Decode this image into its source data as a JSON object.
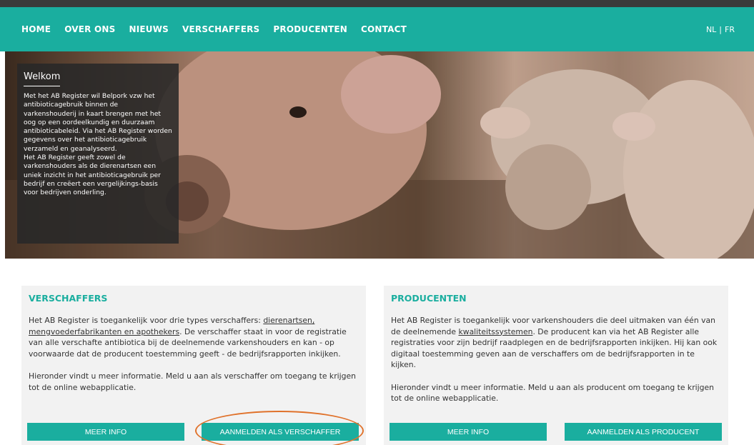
{
  "nav": {
    "items": [
      "HOME",
      "OVER ONS",
      "NIEUWS",
      "VERSCHAFFERS",
      "PRODUCENTEN",
      "CONTACT"
    ],
    "lang_nl": "NL",
    "lang_sep": "|",
    "lang_fr": "FR"
  },
  "hero": {
    "title": "Welkom",
    "text": "Met het AB Register wil Belpork vzw het antibioticagebruik binnen de varkenshouderij in kaart brengen met het oog op een oordeelkundig en duurzaam antibioticabeleid. Via het AB Register worden gegevens over het antibioticagebruik verzameld en geanalyseerd.\nHet AB Register geeft zowel de varkenshouders als de dierenartsen een uniek inzicht in het antibioticagebruik per bedrijf en creëert een vergelijkings-basis voor bedrijven onderling."
  },
  "verschaffers": {
    "title": "VERSCHAFFERS",
    "p1_start": "Het AB Register is toegankelijk voor drie types verschaffers: ",
    "p1_link": "dierenartsen, mengvoederfabrikanten en apothekers",
    "p1_end": ". De verschaffer staat in voor de registratie van alle verschafte antibiotica bij de deelnemende varkenshouders en kan - op voorwaarde dat de producent toestemming geeft - de bedrijfsrapporten inkijken.",
    "p2": "Hieronder vindt u meer informatie. Meld u aan als verschaffer om toegang te krijgen tot de online webapplicatie.",
    "btn_info": "MEER INFO",
    "btn_register": "AANMELDEN ALS VERSCHAFFER"
  },
  "producenten": {
    "title": "PRODUCENTEN",
    "p1_start": "Het AB Register is toegankelijk voor varkenshouders die deel uitmaken van één van de deelnemende ",
    "p1_link": "kwaliteitssystemen",
    "p1_end": ". De producent kan via het AB Register alle registraties voor zijn bedrijf raadplegen en de bedrijfsrapporten inkijken. Hij kan ook digitaal toestemming geven aan de verschaffers om de bedrijfsrapporten in te kijken.",
    "p2": "Hieronder vindt u meer informatie. Meld u aan als producent om toegang te krijgen tot de online webapplicatie.",
    "btn_info": "MEER INFO",
    "btn_register": "AANMELDEN ALS PRODUCENT"
  },
  "colors": {
    "teal": "#1aae9f",
    "highlight": "#e0722b",
    "panel": "#f2f2f2"
  }
}
